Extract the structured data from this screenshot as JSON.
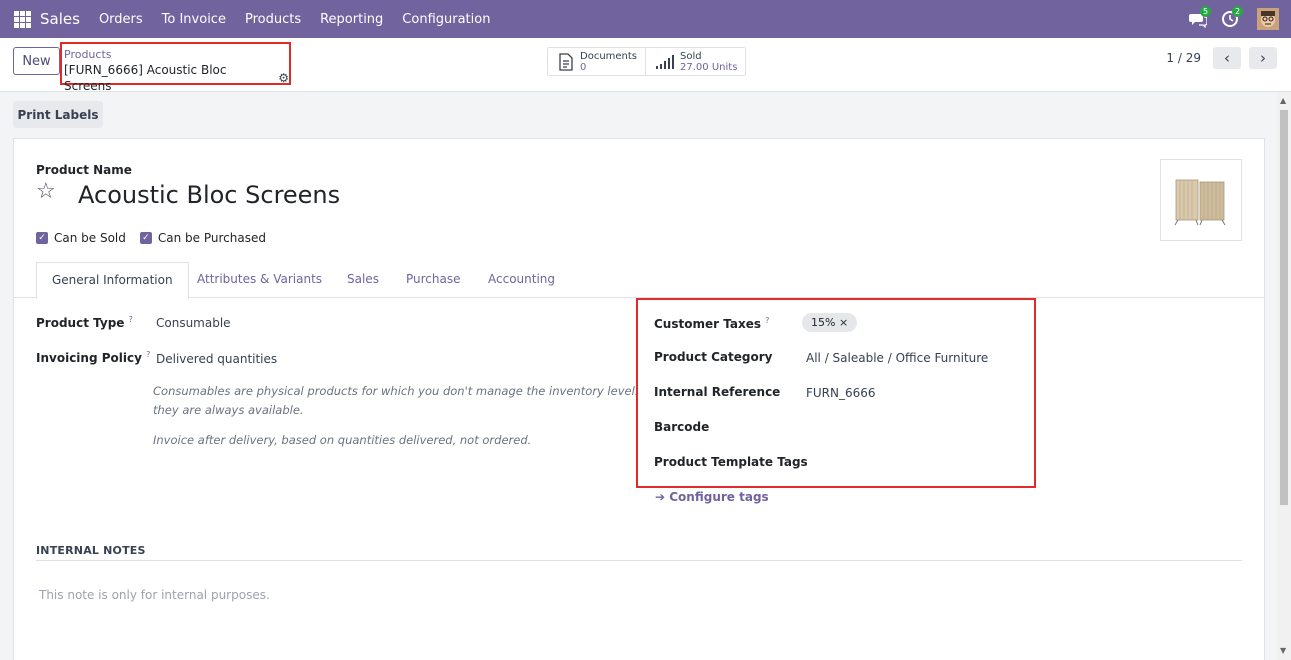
{
  "navbar": {
    "app_name": "Sales",
    "menu": [
      "Orders",
      "To Invoice",
      "Products",
      "Reporting",
      "Configuration"
    ],
    "messages_badge": "5",
    "activities_badge": "2"
  },
  "control_panel": {
    "new_label": "New",
    "breadcrumb_parent": "Products",
    "breadcrumb_current": "[FURN_6666] Acoustic Bloc Screens",
    "smart_buttons": [
      {
        "label": "Documents",
        "value": "0",
        "icon": "document-icon"
      },
      {
        "label": "Sold",
        "value": "27.00 Units",
        "icon": "bar-chart-icon"
      }
    ],
    "pager_value": "1 / 29"
  },
  "status_bar": {
    "print_labels": "Print Labels"
  },
  "form": {
    "product_name_label": "Product Name",
    "product_name": "Acoustic Bloc Screens",
    "can_be_sold": "Can be Sold",
    "can_be_purchased": "Can be Purchased",
    "tabs": [
      "General Information",
      "Attributes & Variants",
      "Sales",
      "Purchase",
      "Accounting"
    ],
    "product_type_label": "Product Type",
    "product_type": "Consumable",
    "invoicing_policy_label": "Invoicing Policy",
    "invoicing_policy": "Delivered quantities",
    "help_consumable_1": "Consumables are physical products for which you don't manage the inventory level:",
    "help_consumable_2": "they are always available.",
    "help_invoice": "Invoice after delivery, based on quantities delivered, not ordered.",
    "customer_taxes_label": "Customer Taxes",
    "customer_taxes_tag": "15%",
    "product_category_label": "Product Category",
    "product_category": "All / Saleable / Office Furniture",
    "internal_reference_label": "Internal Reference",
    "internal_reference": "FURN_6666",
    "barcode_label": "Barcode",
    "template_tags_label": "Product Template Tags",
    "configure_tags": "Configure tags",
    "internal_notes_header": "INTERNAL NOTES",
    "internal_notes_placeholder": "This note is only for internal purposes."
  },
  "colors": {
    "brand": "#71639e",
    "highlight_box": "#e02b2b"
  }
}
